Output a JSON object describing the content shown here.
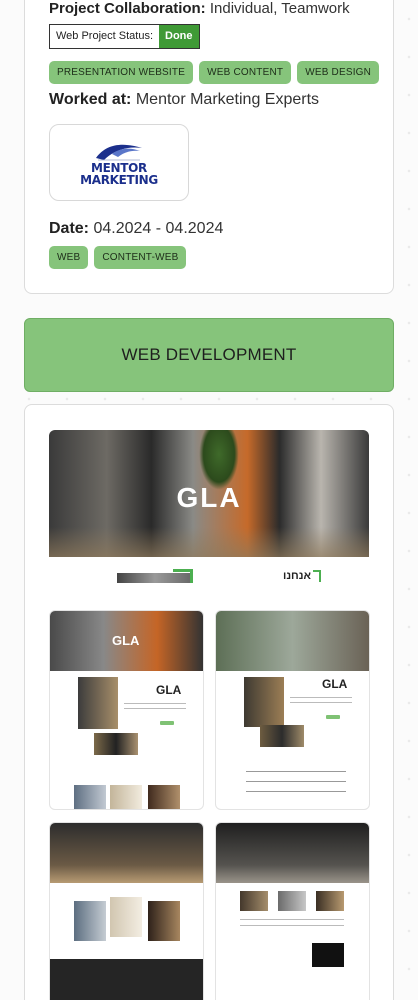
{
  "project": {
    "collab_label": "Project Collaboration:",
    "collab_value": "Individual, Teamwork",
    "status_label": "Web Project Status:",
    "status_value": "Done",
    "tags_primary": [
      "PRESENTATION WEBSITE",
      "WEB CONTENT",
      "WEB DESIGN"
    ],
    "worked_label": "Worked at:",
    "worked_value": "Mentor Marketing Experts",
    "logo_line1": "MENTOR",
    "logo_line2": "MARKETING",
    "date_label": "Date:",
    "date_value": "04.2024 - 04.2024",
    "tags_secondary": [
      "WEB",
      "CONTENT-WEB"
    ]
  },
  "section": {
    "title": "WEB DEVELOPMENT"
  },
  "gallery": {
    "hero_logo": "GLA",
    "hero_heb": "אנחנו",
    "thumb_logo": "GLA",
    "thumb_heb_1": "הדרך",
    "thumb_heb_2": "ניהול פרויקטים"
  },
  "colors": {
    "accent_green": "#86c47b",
    "status_done": "#3f9a36",
    "logo_blue": "#1b2f8c"
  }
}
